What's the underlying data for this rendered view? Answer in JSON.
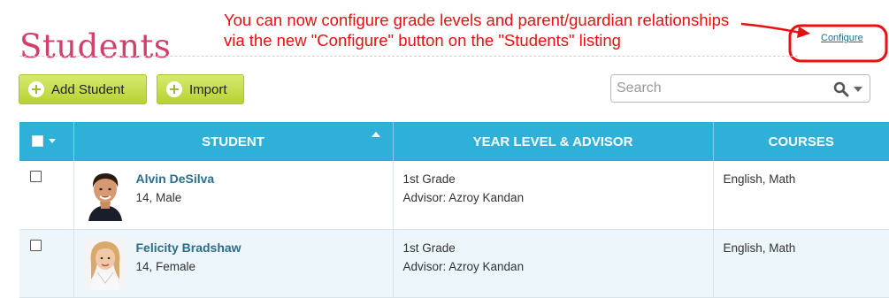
{
  "page": {
    "title": "Students"
  },
  "annotation": {
    "line1": "You can now configure grade levels and parent/guardian relationships",
    "line2": "via the new \"Configure\" button on the \"Students\" listing",
    "color": "#e81010"
  },
  "toolbar": {
    "configure_label": "Configure",
    "add_student_label": "Add Student",
    "import_label": "Import"
  },
  "search": {
    "placeholder": "Search"
  },
  "table": {
    "headers": {
      "student": "STUDENT",
      "year_level_advisor": "YEAR LEVEL & ADVISOR",
      "courses": "COURSES"
    },
    "rows": [
      {
        "name": "Alvin DeSilva",
        "meta": "14, Male",
        "grade": "1st Grade",
        "advisor": "Advisor: Azroy Kandan",
        "courses": "English, Math",
        "avatar": "boy-photo"
      },
      {
        "name": "Felicity Bradshaw",
        "meta": "14, Female",
        "grade": "1st Grade",
        "advisor": "Advisor: Azroy Kandan",
        "courses": "English, Math",
        "avatar": "girl-photo"
      }
    ]
  },
  "colors": {
    "title": "#d0406a",
    "header_bg": "#2fb0d9",
    "button_bg": "#c4dc4a",
    "link": "#2b6e8a"
  },
  "icons": {
    "plus": "plus-circle-icon",
    "search": "magnifier-icon",
    "caret": "chevron-down-icon",
    "sort": "sort-ascending-icon"
  }
}
